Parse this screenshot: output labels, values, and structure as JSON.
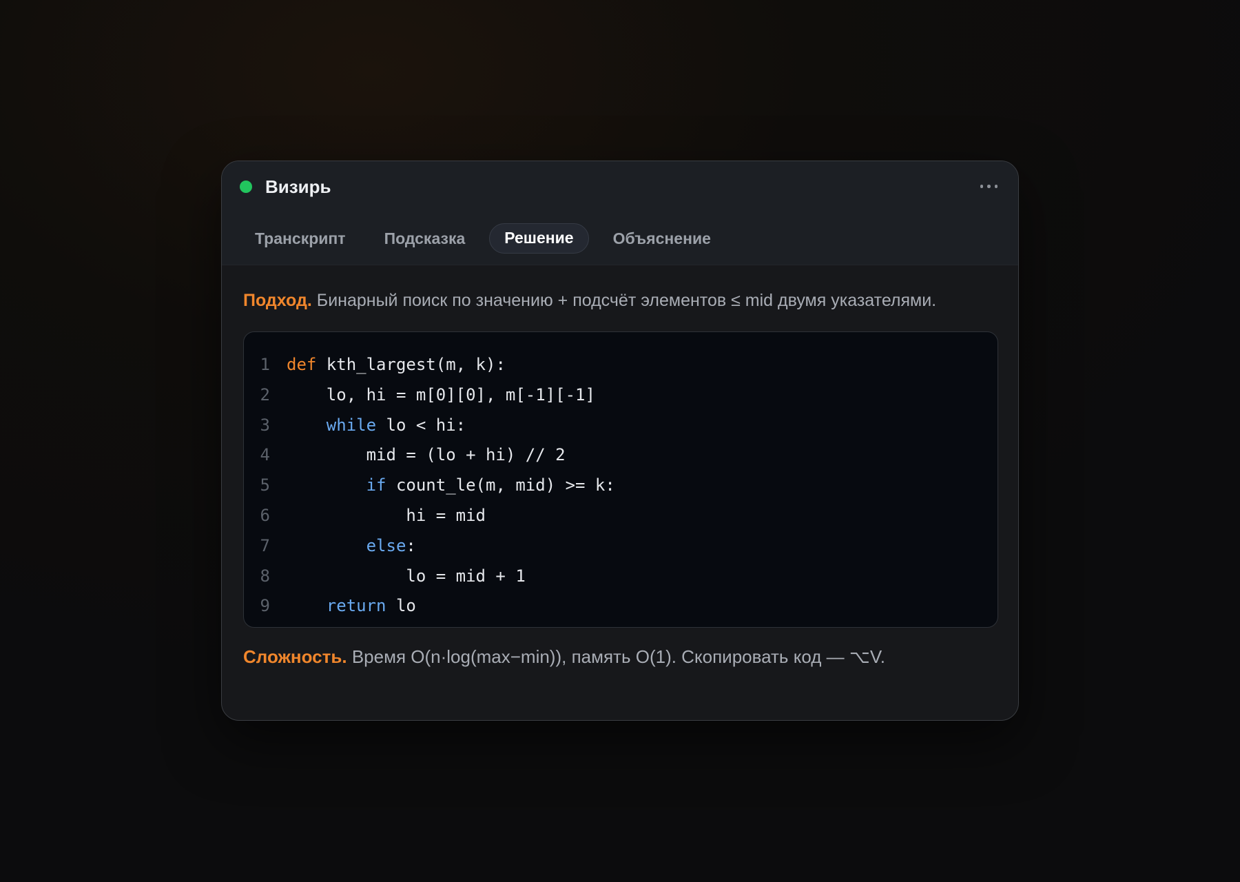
{
  "app": {
    "title": "Визирь",
    "status_color": "#22c55e"
  },
  "menu_icon": "more-horizontal-icon",
  "tabs": [
    {
      "label": "Транскрипт",
      "active": false
    },
    {
      "label": "Подсказка",
      "active": false
    },
    {
      "label": "Решение",
      "active": true
    },
    {
      "label": "Объяснение",
      "active": false
    }
  ],
  "approach": {
    "lead": "Подход.",
    "text": "Бинарный поиск по значению + подсчёт элементов ≤ mid двумя указателями."
  },
  "code": {
    "language": "python",
    "lines": [
      {
        "n": "1",
        "tokens": [
          {
            "t": "def",
            "k": "def"
          },
          {
            "t": " kth_largest(m, k):",
            "k": "t"
          }
        ]
      },
      {
        "n": "2",
        "tokens": [
          {
            "t": "    lo, hi = m[0][0], m[-1][-1]",
            "k": "t"
          }
        ]
      },
      {
        "n": "3",
        "tokens": [
          {
            "t": "    ",
            "k": "t"
          },
          {
            "t": "while",
            "k": "kw"
          },
          {
            "t": " lo < hi:",
            "k": "t"
          }
        ]
      },
      {
        "n": "4",
        "tokens": [
          {
            "t": "        mid = (lo + hi) // 2",
            "k": "t"
          }
        ]
      },
      {
        "n": "5",
        "tokens": [
          {
            "t": "        ",
            "k": "t"
          },
          {
            "t": "if",
            "k": "kw"
          },
          {
            "t": " count_le(m, mid) >= k:",
            "k": "t"
          }
        ]
      },
      {
        "n": "6",
        "tokens": [
          {
            "t": "            hi = mid",
            "k": "t"
          }
        ]
      },
      {
        "n": "7",
        "tokens": [
          {
            "t": "        ",
            "k": "t"
          },
          {
            "t": "else",
            "k": "kw"
          },
          {
            "t": ":",
            "k": "t"
          }
        ]
      },
      {
        "n": "8",
        "tokens": [
          {
            "t": "            lo = mid + 1",
            "k": "t"
          }
        ]
      },
      {
        "n": "9",
        "tokens": [
          {
            "t": "    ",
            "k": "t"
          },
          {
            "t": "return",
            "k": "kw"
          },
          {
            "t": " lo",
            "k": "t"
          }
        ]
      }
    ]
  },
  "complexity": {
    "lead": "Сложность.",
    "text": "Время O(n·log(max−min)), память O(1). Скопировать код — ⌥V."
  },
  "colors": {
    "accent": "#f0862c",
    "keyword": "#6aaaf0",
    "active_tab_bg": "#242831"
  }
}
